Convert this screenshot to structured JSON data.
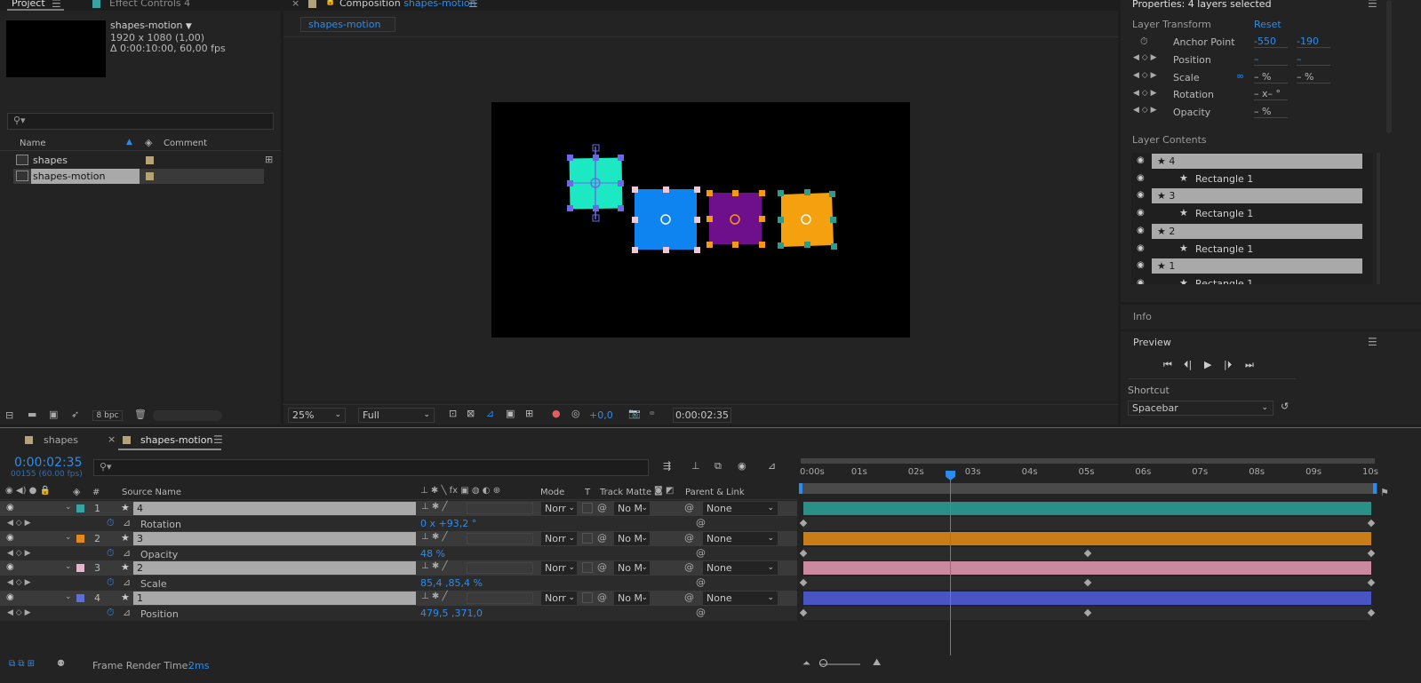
{
  "project_panel": {
    "tab_project": "Project",
    "tab_effect_controls": "Effect Controls 4",
    "comp_name": "shapes-motion",
    "comp_resolution": "1920 x 1080 (1,00)",
    "comp_duration": "Δ 0:00:10:00, 60,00 fps",
    "search_placeholder": "",
    "col_name": "Name",
    "col_comment": "Comment",
    "items": [
      {
        "label": "shapes",
        "selected": false
      },
      {
        "label": "shapes-motion",
        "selected": true
      }
    ],
    "bpc": "8 bpc"
  },
  "composition_panel": {
    "title_prefix": "Composition",
    "title_name": "shapes-motion",
    "tab": "shapes-motion",
    "zoom": "25%",
    "quality": "Full",
    "exposure": "+0,0",
    "timecode": "0:00:02:35",
    "shape_colors": {
      "layer4": "#1de8c4",
      "layer3": "#0d84f0",
      "layer2": "#6e0f8c",
      "layer1": "#f5a00e"
    }
  },
  "properties_panel": {
    "title": "Properties: 4 layers selected",
    "layer_transform": "Layer Transform",
    "reset": "Reset",
    "props": [
      {
        "label": "Anchor Point",
        "v1": "-550",
        "v2": "-190"
      },
      {
        "label": "Position",
        "v1": "–",
        "v2": "–"
      },
      {
        "label": "Scale",
        "v1": "– %",
        "v2": "– %"
      },
      {
        "label": "Rotation",
        "v1": "– x– °",
        "v2": ""
      },
      {
        "label": "Opacity",
        "v1": "– %",
        "v2": ""
      }
    ],
    "layer_contents": "Layer Contents",
    "contents": [
      {
        "label": "4",
        "type": "layer"
      },
      {
        "label": "Rectangle 1",
        "type": "child"
      },
      {
        "label": "3",
        "type": "layer"
      },
      {
        "label": "Rectangle 1",
        "type": "child"
      },
      {
        "label": "2",
        "type": "layer"
      },
      {
        "label": "Rectangle 1",
        "type": "child"
      },
      {
        "label": "1",
        "type": "layer"
      },
      {
        "label": "Rectangle 1",
        "type": "child"
      }
    ],
    "info": "Info",
    "preview": "Preview",
    "shortcut_label": "Shortcut",
    "shortcut_value": "Spacebar"
  },
  "timeline": {
    "tabs": [
      {
        "label": "shapes",
        "active": false
      },
      {
        "label": "shapes-motion",
        "active": true
      }
    ],
    "current_time": "0:00:02:35",
    "current_frames": "00155 (60.00 fps)",
    "col_num": "#",
    "col_source": "Source Name",
    "col_mode": "Mode",
    "col_t": "T",
    "col_track_matte": "Track Matte",
    "col_parent": "Parent & Link",
    "ruler": [
      "0:00s",
      "01s",
      "02s",
      "03s",
      "04s",
      "05s",
      "06s",
      "07s",
      "08s",
      "09s",
      "10s"
    ],
    "playhead_seconds": 2.583,
    "layers": [
      {
        "num": "1",
        "name": "4",
        "color": "#39a3a3",
        "bar": "#2a8f86",
        "mode": "Norr",
        "matte": "No M",
        "parent": "None",
        "prop": "Rotation",
        "value": "0 x +93,2 °",
        "keyframes_s": [
          0,
          10
        ]
      },
      {
        "num": "2",
        "name": "3",
        "color": "#e0891c",
        "bar": "#c97d16",
        "mode": "Norr",
        "matte": "No M",
        "parent": "None",
        "prop": "Opacity",
        "value": "48 %",
        "keyframes_s": [
          0,
          5,
          10
        ]
      },
      {
        "num": "3",
        "name": "2",
        "color": "#e7b6cc",
        "bar": "#c9899f",
        "mode": "Norr",
        "matte": "No M",
        "parent": "None",
        "prop": "Scale",
        "value": "85,4 ,85,4 %",
        "keyframes_s": [
          0,
          5,
          10
        ]
      },
      {
        "num": "4",
        "name": "1",
        "color": "#5a6fd8",
        "bar": "#4a55c4",
        "mode": "Norr",
        "matte": "No M",
        "parent": "None",
        "prop": "Position",
        "value": "479,5 ,371,0",
        "keyframes_s": [
          0,
          5,
          10
        ]
      }
    ],
    "frame_render_label": "Frame Render Time:",
    "frame_render_value": "2ms"
  }
}
